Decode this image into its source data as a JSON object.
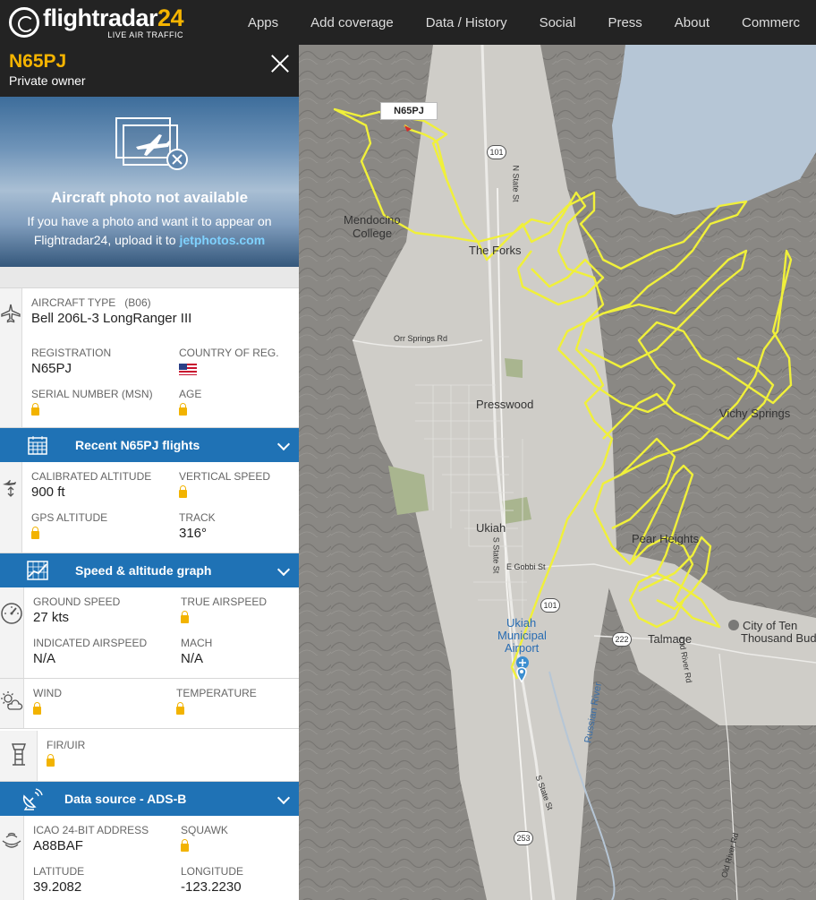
{
  "nav": {
    "logo_name": "flightradar",
    "logo_num": "24",
    "logo_tag": "LIVE AIR TRAFFIC",
    "items": [
      "Apps",
      "Add coverage",
      "Data / History",
      "Social",
      "Press",
      "About",
      "Commerc"
    ]
  },
  "header": {
    "callsign": "N65PJ",
    "owner": "Private owner"
  },
  "photo": {
    "title": "Aircraft photo not available",
    "text": "If you have a photo and want it to appear on Flightradar24, upload it to ",
    "link": "jetphotos.com"
  },
  "aircraft": {
    "type_label": "AIRCRAFT TYPE",
    "type_code": "(B06)",
    "type_value": "Bell 206L-3 LongRanger III",
    "registration_label": "REGISTRATION",
    "registration_value": "N65PJ",
    "country_label": "COUNTRY OF REG.",
    "serial_label": "SERIAL NUMBER (MSN)",
    "age_label": "AGE"
  },
  "recent_flights": {
    "label": "Recent N65PJ flights"
  },
  "altitude": {
    "calibrated_label": "CALIBRATED ALTITUDE",
    "calibrated_value": "900 ft",
    "vspeed_label": "VERTICAL SPEED",
    "gps_label": "GPS ALTITUDE",
    "track_label": "TRACK",
    "track_value": "316°"
  },
  "speed_graph": {
    "label": "Speed & altitude graph"
  },
  "speed": {
    "ground_label": "GROUND SPEED",
    "ground_value": "27 kts",
    "true_label": "TRUE AIRSPEED",
    "indicated_label": "INDICATED AIRSPEED",
    "indicated_value": "N/A",
    "mach_label": "MACH",
    "mach_value": "N/A"
  },
  "weather": {
    "wind_label": "WIND",
    "temp_label": "TEMPERATURE"
  },
  "fir": {
    "label": "FIR/UIR"
  },
  "data_source": {
    "label": "Data source - ADS-B"
  },
  "transponder": {
    "icao_label": "ICAO 24-BIT ADDRESS",
    "icao_value": "A88BAF",
    "squawk_label": "SQUAWK",
    "lat_label": "LATITUDE",
    "lat_value": "39.2082",
    "lon_label": "LONGITUDE",
    "lon_value": "-123.2230"
  },
  "map": {
    "callout": "N65PJ",
    "places": {
      "mendocino": "Mendocino",
      "college": "College",
      "forks": "The Forks",
      "presswood": "Presswood",
      "ukiah": "Ukiah",
      "vichy": "Vichy Springs",
      "pearl": "Pear Heights",
      "airport1": "Ukiah",
      "airport2": "Municipal",
      "airport3": "Airport",
      "talmage": "Talmage",
      "ten1": "City of Ten",
      "ten2": "Thousand Bud",
      "river": "Russian River"
    },
    "roads": {
      "orr": "Orr Springs Rd",
      "nstate": "N State St",
      "sstate": "S State St",
      "sstate2": "S State St",
      "gobbi": "E Gobbi St",
      "oldriver": "Old River Rd",
      "oldriver2": "Old River Rd"
    },
    "shields": {
      "us101a": "101",
      "us101b": "101",
      "ca222": "222",
      "ca253": "253"
    },
    "track_color": "#f0f03a"
  }
}
